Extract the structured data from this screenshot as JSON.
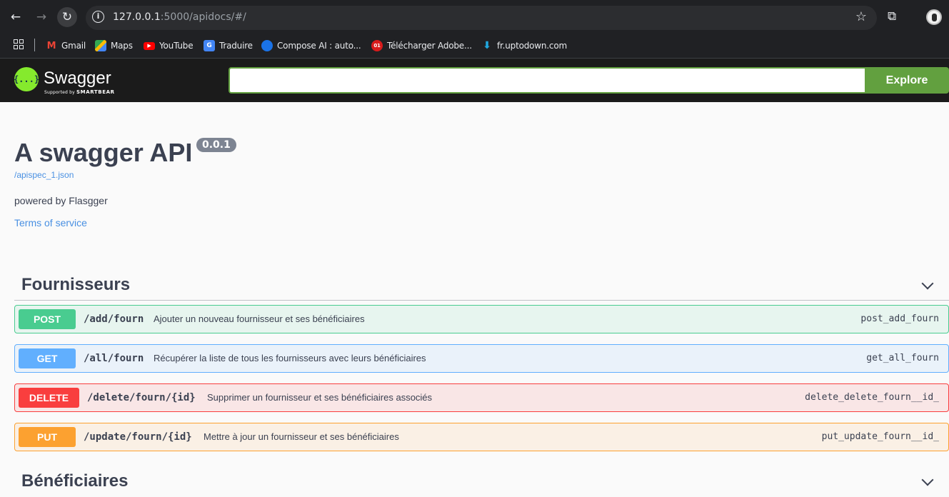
{
  "browser": {
    "url_host": "127.0.0.1",
    "url_rest": ":5000/apidocs/#/",
    "bookmarks": [
      {
        "label": "Gmail",
        "icon": "gmail-icon",
        "fav_text": "M",
        "color": "#ea4335"
      },
      {
        "label": "Maps",
        "icon": "maps-icon",
        "fav_text": "",
        "color": "#34a853"
      },
      {
        "label": "YouTube",
        "icon": "youtube-icon",
        "fav_text": "▶",
        "color": "#ff0000"
      },
      {
        "label": "Traduire",
        "icon": "translate-icon",
        "fav_text": "G",
        "color": "#4285f4"
      },
      {
        "label": "Compose AI : auto...",
        "icon": "compose-ai-icon",
        "fav_text": "",
        "color": "#1a73e8"
      },
      {
        "label": "Télécharger Adobe...",
        "icon": "download-01-icon",
        "fav_text": "01",
        "color": "#d81b1b"
      },
      {
        "label": "fr.uptodown.com",
        "icon": "uptodown-icon",
        "fav_text": "",
        "color": "#20a8e0"
      }
    ]
  },
  "topbar": {
    "logo_text": "{...}",
    "brand": "Swagger",
    "sub_prefix": "Supported by",
    "sub_brand": "SMARTBEAR",
    "explore_value": "",
    "explore_label": "Explore"
  },
  "info": {
    "title": "A swagger API",
    "version": "0.0.1",
    "spec_link": "/apispec_1.json",
    "description": "powered by Flasgger",
    "tos": "Terms of service"
  },
  "tags": [
    {
      "name": "Fournisseurs",
      "operations": [
        {
          "method": "POST",
          "path": "/add/fourn",
          "summary": "Ajouter un nouveau fournisseur et ses bénéficiaires",
          "operation_id": "post_add_fourn"
        },
        {
          "method": "GET",
          "path": "/all/fourn",
          "summary": "Récupérer la liste de tous les fournisseurs avec leurs bénéficiaires",
          "operation_id": "get_all_fourn"
        },
        {
          "method": "DELETE",
          "path": "/delete/fourn/{id}",
          "summary": "Supprimer un fournisseur et ses bénéficiaires associés",
          "operation_id": "delete_delete_fourn__id_"
        },
        {
          "method": "PUT",
          "path": "/update/fourn/{id}",
          "summary": "Mettre à jour un fournisseur et ses bénéficiaires",
          "operation_id": "put_update_fourn__id_"
        }
      ]
    },
    {
      "name": "Bénéficiaires",
      "operations": []
    }
  ],
  "colors": {
    "post": "#49cc90",
    "get": "#61affe",
    "delete": "#f93e3e",
    "put": "#fca130",
    "explore": "#62a03f"
  }
}
